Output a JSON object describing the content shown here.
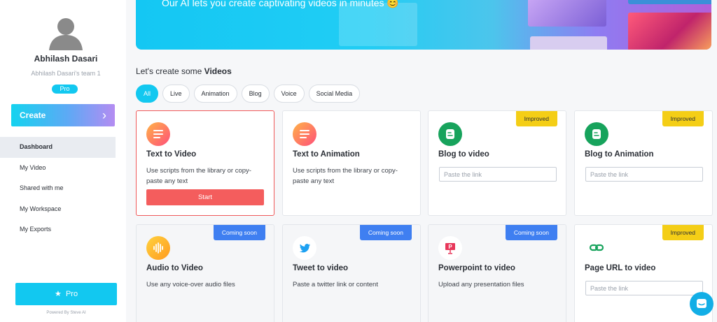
{
  "sidebar": {
    "user_name": "Abhilash Dasari",
    "team_name": "Abhilash Dasari's team 1",
    "plan_badge": "Pro",
    "create_label": "Create",
    "nav": [
      "Dashboard",
      "My Video",
      "Shared with me",
      "My Workspace",
      "My Exports"
    ],
    "pro_button_label": "Pro",
    "powered_by": "Powered By Steve AI"
  },
  "banner": {
    "text": "Our AI lets you create captivating videos in minutes 😊"
  },
  "section": {
    "heading_prefix": "Let's create some ",
    "heading_bold": "Videos"
  },
  "filters": [
    "All",
    "Live",
    "Animation",
    "Blog",
    "Voice",
    "Social Media"
  ],
  "cards": [
    {
      "title": "Text to Video",
      "desc": "Use scripts from the library or copy-paste any text",
      "button": "Start"
    },
    {
      "title": "Text to Animation",
      "desc": "Use scripts from the library or copy-paste any text"
    },
    {
      "title": "Blog to video",
      "tag": "Improved",
      "input_placeholder": "Paste the link"
    },
    {
      "title": "Blog to Animation",
      "tag": "Improved",
      "input_placeholder": "Paste the link"
    },
    {
      "title": "Audio to Video",
      "tag": "Coming soon",
      "desc": "Use any voice-over audio files"
    },
    {
      "title": "Tweet to video",
      "tag": "Coming soon",
      "desc": "Paste a twitter link or content"
    },
    {
      "title": "Powerpoint to video",
      "tag": "Coming soon",
      "desc": "Upload any presentation files"
    },
    {
      "title": "Page URL to video",
      "tag": "Improved",
      "input_placeholder": "Paste the link"
    }
  ],
  "colors": {
    "accent": "#12c8f0",
    "start_button": "#f45d5d",
    "improved_tag": "#f4ce16",
    "coming_soon_tag": "#3f7ff1"
  },
  "icons": {
    "text_to_video": "text-lines-icon",
    "text_to_animation": "text-lines-icon",
    "blog_to_video": "blogger-icon",
    "blog_to_animation": "blogger-icon",
    "audio_to_video": "audio-wave-icon",
    "tweet_to_video": "twitter-bird-icon",
    "powerpoint_to_video": "powerpoint-icon",
    "page_url_to_video": "link-icon"
  }
}
